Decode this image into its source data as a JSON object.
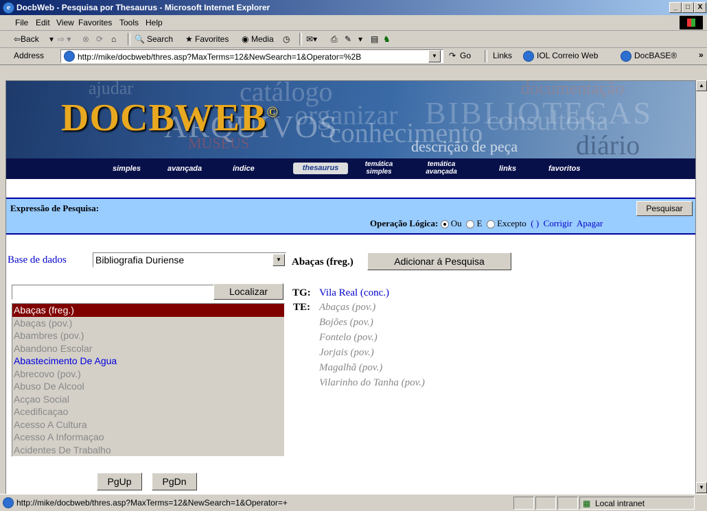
{
  "window": {
    "title": "DocbWeb - Pesquisa por Thesaurus - Microsoft Internet Explorer",
    "min_label": "_",
    "max_label": "□",
    "close_label": "X"
  },
  "menu": [
    "File",
    "Edit",
    "View",
    "Favorites",
    "Tools",
    "Help"
  ],
  "toolbar": {
    "back": "⇦Back",
    "search": "Search",
    "favorites": "Favorites",
    "media": "Media"
  },
  "address": {
    "label": "Address",
    "url": "http://mike/docbweb/thres.asp?MaxTerms=12&NewSearch=1&Operator=%2B",
    "go": "Go",
    "links_label": "Links",
    "link1": "IOL Correio Web",
    "link2": "DocBASE®",
    "chevron": "»"
  },
  "banner": {
    "logo": "DOCBWEB",
    "logo_reg": "©",
    "words": [
      "ajudar",
      "catálogo",
      "organizar",
      "BIBLIOTECAS",
      "documentação",
      "consultoria",
      "ARQUIVOS",
      "MUSEUS",
      "conhecimento",
      "descrição de peça",
      "diário"
    ]
  },
  "nav": {
    "simples": "simples",
    "avancada": "avançada",
    "indice": "índice",
    "thesaurus": "thesaurus",
    "tematica_simples_1": "temática",
    "tematica_simples_2": "simples",
    "tematica_avancada_1": "temática",
    "tematica_avancada_2": "avançada",
    "links": "links",
    "favoritos": "favoritos"
  },
  "search": {
    "expression_label": "Expressão de Pesquisa:",
    "button": "Pesquisar",
    "operation_label": "Operação Lógica:",
    "op_ou": "Ou",
    "op_e": "E",
    "op_excepto": "Excepto",
    "paren": "( )",
    "corrigir": "Corrigir",
    "apagar": "Apagar",
    "selected_op": "Ou"
  },
  "database": {
    "label": "Base de dados",
    "value": "Bibliografia Duriense"
  },
  "locate": {
    "input_value": "",
    "button": "Localizar"
  },
  "terms": [
    {
      "text": "Abaças (freg.)",
      "state": "selected"
    },
    {
      "text": "Abaças (pov.)",
      "state": "normal"
    },
    {
      "text": "Abambres (pov.)",
      "state": "normal"
    },
    {
      "text": "Abandono Escolar",
      "state": "normal"
    },
    {
      "text": "Abastecimento De Agua",
      "state": "link"
    },
    {
      "text": "Abrecovo (pov.)",
      "state": "normal"
    },
    {
      "text": "Abuso De Alcool",
      "state": "normal"
    },
    {
      "text": "Acçao Social",
      "state": "normal"
    },
    {
      "text": "Acedificaçao",
      "state": "normal"
    },
    {
      "text": "Acesso A Cultura",
      "state": "normal"
    },
    {
      "text": "Acesso A Informaçao",
      "state": "normal"
    },
    {
      "text": "Acidentes De Trabalho",
      "state": "normal"
    }
  ],
  "paging": {
    "up": "PgUp",
    "down": "PgDn"
  },
  "detail": {
    "term": "Abaças (freg.)",
    "add_button": "Adicionar á Pesquisa",
    "tg_label": "TG:",
    "tg_value": "Vila Real (conc.)",
    "te_label": "TE:",
    "te_values": [
      "Abaças (pov.)",
      "Bojões (pov.)",
      "Fontelo (pov.)",
      "Jorjais (pov.)",
      "Magalhã (pov.)",
      "Vilarinho do Tanha (pov.)"
    ]
  },
  "status": {
    "url": "http://mike/docbweb/thres.asp?MaxTerms=12&NewSearch=1&Operator=+",
    "zone": "Local intranet"
  }
}
